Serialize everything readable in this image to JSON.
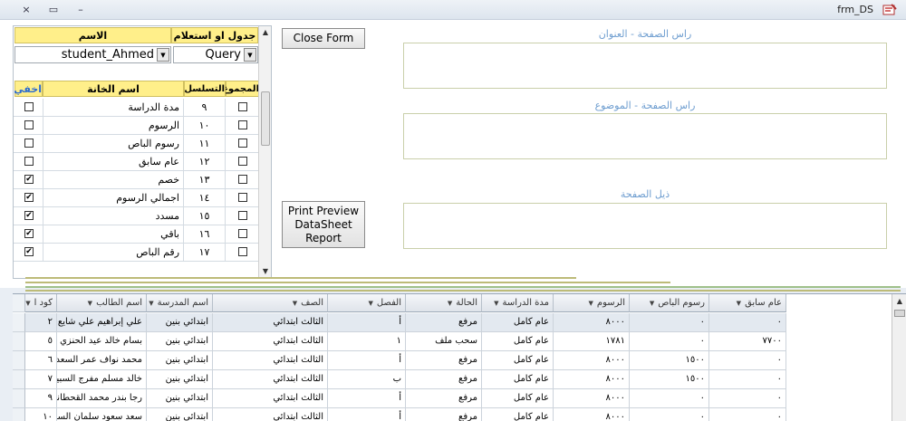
{
  "window": {
    "title": "frm_DS",
    "close_glyph": "×",
    "restore_glyph": "▭",
    "minimize_glyph": "–"
  },
  "fields_panel": {
    "header_name": "الاسم",
    "header_table": "جدول او استعلام",
    "name_value": "student_Ahmed",
    "table_value": "Query",
    "col_sum": "المجموع",
    "col_seq": "التسلسل",
    "col_name": "اسم الخانة",
    "col_hide": "اخفي",
    "rows": [
      {
        "seq": "٩",
        "name": "مدة الدراسة",
        "hide": false,
        "sum": false
      },
      {
        "seq": "١٠",
        "name": "الرسوم",
        "hide": false,
        "sum": false
      },
      {
        "seq": "١١",
        "name": "رسوم الباص",
        "hide": false,
        "sum": false
      },
      {
        "seq": "١٢",
        "name": "عام سابق",
        "hide": false,
        "sum": false
      },
      {
        "seq": "١٣",
        "name": "خصم",
        "hide": true,
        "sum": false
      },
      {
        "seq": "١٤",
        "name": "اجمالي الرسوم",
        "hide": true,
        "sum": false
      },
      {
        "seq": "١٥",
        "name": "مسدد",
        "hide": true,
        "sum": false
      },
      {
        "seq": "١٦",
        "name": "باقي",
        "hide": true,
        "sum": false
      },
      {
        "seq": "١٧",
        "name": "رقم الباص",
        "hide": true,
        "sum": false
      }
    ]
  },
  "buttons": {
    "close_form": "Close Form",
    "print_preview_l1": "Print Preview",
    "print_preview_l2": "DataSheet",
    "print_preview_l3": "Report"
  },
  "sections": {
    "header_title": "راس الصفحة - العنوان",
    "header_subject": "راس الصفحة - الموضوع",
    "footer": "ذيل الصفحة"
  },
  "datasheet": {
    "columns": [
      "كود ا",
      "اسم الطالب",
      "اسم المدرسة",
      "الصف",
      "الفصل",
      "الحالة",
      "مدة الدراسة",
      "الرسوم",
      "رسوم الباص",
      "عام سابق"
    ],
    "rows": [
      [
        "٢",
        "علي إبراهيم علي شايع القد",
        "ابتدائي بنين",
        "الثالث ابتدائي",
        "أ",
        "مرفع",
        "عام كامل",
        "٨٠٠٠",
        "٠",
        "٠"
      ],
      [
        "٥",
        "بسام خالد عيد الحنزي",
        "ابتدائي بنين",
        "الثالث ابتدائي",
        "١",
        "سحب ملف",
        "عام كامل",
        "١٧٨١",
        "٠",
        "٧٧٠٠"
      ],
      [
        "٦",
        "محمد نواف عمر السعدون",
        "ابتدائي بنين",
        "الثالث ابتدائي",
        "أ",
        "مرفع",
        "عام كامل",
        "٨٠٠٠",
        "١٥٠٠",
        "٠"
      ],
      [
        "٧",
        "خالد مسلم مفرج السبيعي",
        "ابتدائي بنين",
        "الثالث ابتدائي",
        "ب",
        "مرفع",
        "عام كامل",
        "٨٠٠٠",
        "١٥٠٠",
        "٠"
      ],
      [
        "٩",
        "رجا بندر محمد القحطاني",
        "ابتدائي بنين",
        "الثالث ابتدائي",
        "أ",
        "مرفع",
        "عام كامل",
        "٨٠٠٠",
        "٠",
        "٠"
      ],
      [
        "١٠",
        "سعد سعود سلمان السهلي",
        "ابتدائي بنين",
        "الثالث ابتدائي",
        "أ",
        "مرفع",
        "عام كامل",
        "٨٠٠٠",
        "٠",
        "٠"
      ]
    ]
  },
  "colors": {
    "header_yellow": "#ffef8a",
    "line_olive": "#bdbb78",
    "line_green": "#9fc08a",
    "label_blue": "#6f9ed0"
  }
}
